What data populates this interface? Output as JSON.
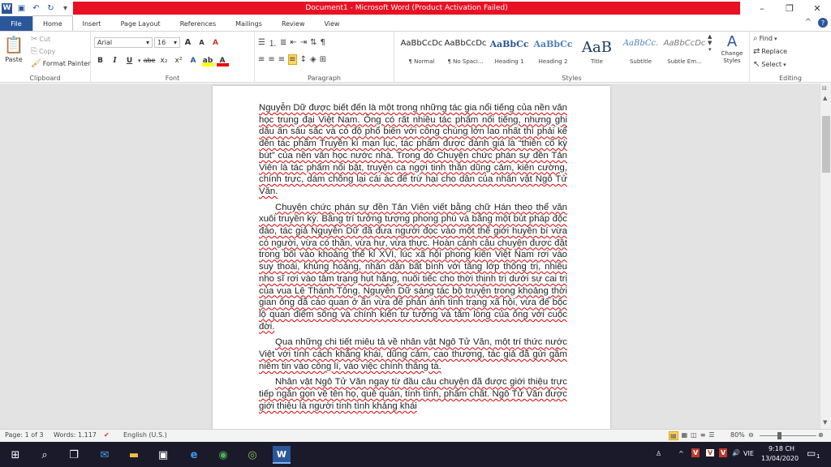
{
  "window": {
    "title": "Document1 - Microsoft Word (Product Activation Failed)",
    "minimize": "–",
    "restore": "❐",
    "close": "✕"
  },
  "qat": {
    "items": [
      "word-logo-icon",
      "save-icon",
      "undo-icon",
      "redo-icon",
      "customize-icon"
    ]
  },
  "tabs": [
    "File",
    "Home",
    "Insert",
    "Page Layout",
    "References",
    "Mailings",
    "Review",
    "View"
  ],
  "tabs_right": {
    "help": "?",
    "minimize_ribbon": "^"
  },
  "ribbon": {
    "clipboard": {
      "label": "Clipboard",
      "paste": "Paste",
      "cut": "Cut",
      "copy": "Copy",
      "format_painter": "Format Painter"
    },
    "font": {
      "label": "Font",
      "name": "Arial",
      "size": "16",
      "bold": "B",
      "italic": "I",
      "underline": "U",
      "strike": "abe",
      "sub": "x₂",
      "sup": "x²",
      "grow": "A",
      "shrink": "A",
      "clear": "A"
    },
    "paragraph": {
      "label": "Paragraph"
    },
    "styles": {
      "label": "Styles",
      "items": [
        {
          "preview": "AaBbCcDc",
          "name": "¶ Normal"
        },
        {
          "preview": "AaBbCcDc",
          "name": "¶ No Spaci..."
        },
        {
          "preview": "AaBbCc",
          "name": "Heading 1"
        },
        {
          "preview": "AaBbCc",
          "name": "Heading 2"
        },
        {
          "preview": "AaB",
          "name": "Title"
        },
        {
          "preview": "AaBbCc.",
          "name": "Subtitle"
        },
        {
          "preview": "AaBbCcDc",
          "name": "Subtle Em..."
        }
      ],
      "change_styles": "Change Styles"
    },
    "editing": {
      "label": "Editing",
      "find": "Find",
      "replace": "Replace",
      "select": "Select"
    }
  },
  "document": {
    "paragraphs": [
      "Nguyễn Dữ được biết đến là một trong những tác gia nổi tiếng của nền văn học trung đại Việt Nam. Ông có rất nhiều tác phẩm nổi tiếng, nhưng ghi dấu ấn sâu sắc và có độ phổ biến với công chúng lớn lao nhất thì phải kể đến tác phẩm Truyền kì mạn lục, tác phẩm được đánh giá là “thiên cổ kỳ bút” của nền văn học nước nhà. Trong đó Chuyện chức phán sự đền Tản Viên là tác phẩm nổi bật, truyện ca ngợi tinh thần dũng cảm, kiên cường, chính trực, dám chống lại cái ác để trừ hại cho dân của nhân vật Ngô Tử Văn.",
      "Chuyện chức phán sự đền Tản Viên viết bằng chữ Hán theo thể văn xuôi truyền kỳ. Bằng trí tưởng tượng phong phú và bằng một bút pháp độc đáo, tác giả Nguyễn Dữ đã đưa người đọc vào một thế giới huyền bí vừa có người, vừa có thần, vừa hư, vừa thực. Hoàn cảnh câu chuyện được đặt trong bối vào khoảng thế kỉ XVI, lúc xã hội phong kiến Việt Nam rơi vào suy thoái, khủng hoảng, nhân dân bất bình với tầng lớp thống trị, nhiều nho sĩ rơi vào tâm trạng hụt hẫng, nuối tiếc cho thời thịnh trị dưới sự cai trị của vua Lê Thánh Tông. Nguyễn Dữ sáng tác bộ truyện trong khoảng thời gian ông đã cáo quan ở ẩn vừa để phản ánh tình trạng xã hội, vừa để bộc lộ quan điểm sống và chính kiến tư tưởng và tấm lòng của ông với cuộc đời.",
      "Qua những chi tiết miêu tả về nhân vật Ngô Tử Văn, một trí thức nước Việt với tính cách khẳng khái, dũng cảm, cao thượng, tác giả đã gửi gắm niềm tin vào công lí, vào việc chính thắng tà.",
      "Nhân vật Ngô Tử Văn ngay từ đầu câu chuyện đã được giới thiệu trực tiếp ngắn gọn về tên họ, quê quán, tính tình, phẩm chất. Ngô Tử Văn được giới thiệu là người tính tình khảng khái"
    ]
  },
  "status": {
    "page": "Page: 1 of 3",
    "words": "Words: 1.117",
    "language": "English (U.S.)",
    "zoom": "80%"
  },
  "taskbar": {
    "lang": "VIE",
    "time": "9:18 CH",
    "date": "13/04/2020",
    "notif": "1"
  }
}
